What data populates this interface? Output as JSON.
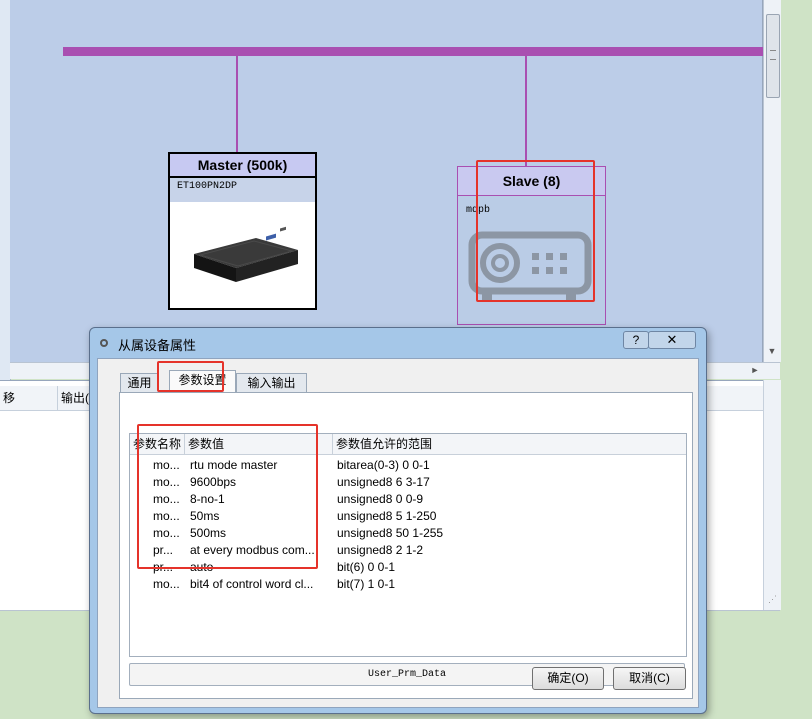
{
  "colors": {
    "bus": "#a94fb1",
    "highlight": "#e5332a",
    "canvas": "#bccde8",
    "master_title_bg": "#c7c9f2"
  },
  "topology": {
    "master": {
      "title": "Master (500k)",
      "subtitle": "ET100PN2DP",
      "image_icon": "mini-pc-icon"
    },
    "slave": {
      "title": "Slave (8)",
      "subtitle": "mdpb",
      "image_icon": "projector-icon"
    }
  },
  "bottom_table": {
    "headers": [
      "移",
      "输出("
    ]
  },
  "dialog": {
    "title": "从属设备属性",
    "help_label": "?",
    "close_label": "✕",
    "tabs": [
      {
        "label": "通用"
      },
      {
        "label": "参数设置"
      },
      {
        "label": "输入输出"
      }
    ],
    "grid": {
      "headers": [
        "参数名称",
        "参数值",
        "参数值允许的范围"
      ],
      "rows": [
        {
          "name": "mo...",
          "value": "rtu mode master",
          "range": "bitarea(0-3) 0 0-1"
        },
        {
          "name": "mo...",
          "value": "9600bps",
          "range": "unsigned8 6 3-17"
        },
        {
          "name": "mo...",
          "value": "8-no-1",
          "range": "unsigned8 0 0-9"
        },
        {
          "name": "mo...",
          "value": "50ms",
          "range": "unsigned8 5 1-250"
        },
        {
          "name": "mo...",
          "value": "500ms",
          "range": "unsigned8 50 1-255"
        },
        {
          "name": "pr...",
          "value": "at every modbus com...",
          "range": "unsigned8 2 1-2"
        },
        {
          "name": "pr...",
          "value": "auto",
          "range": "bit(6) 0 0-1"
        },
        {
          "name": "mo...",
          "value": "bit4 of control word cl...",
          "range": "bit(7) 1 0-1"
        }
      ]
    },
    "user_prm_button": "User_Prm_Data",
    "ok_label": "确定(O)",
    "cancel_label": "取消(C)"
  }
}
